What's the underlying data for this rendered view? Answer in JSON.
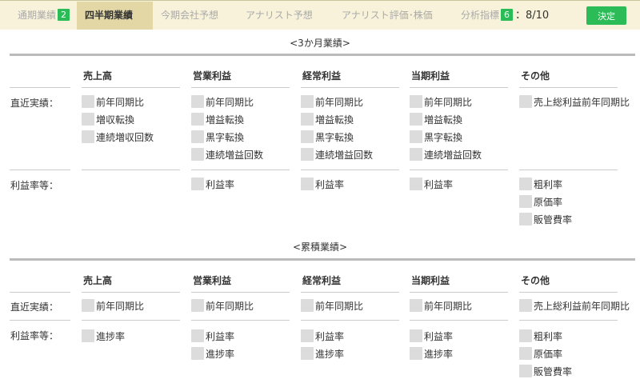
{
  "tabs": [
    {
      "label": "通期業績",
      "badge": "2"
    },
    {
      "label": "四半期業績"
    },
    {
      "label": "今期会社予想"
    },
    {
      "label": "アナリスト予想"
    },
    {
      "label": "アナリスト評価･株価"
    },
    {
      "label": "分析指標",
      "badge": "6"
    }
  ],
  "counter": "：8/10",
  "decide_label": "決定",
  "columns": [
    "売上高",
    "営業利益",
    "経常利益",
    "当期利益",
    "その他"
  ],
  "quarterly": {
    "title": "<3か月業績>",
    "row1_label": "直近実績：",
    "row2_label": "利益率等：",
    "row1": [
      [
        "前年同期比",
        "増収転換",
        "連続増収回数"
      ],
      [
        "前年同期比",
        "増益転換",
        "黒字転換",
        "連続増益回数"
      ],
      [
        "前年同期比",
        "増益転換",
        "黒字転換",
        "連続増益回数"
      ],
      [
        "前年同期比",
        "増益転換",
        "黒字転換",
        "連続増益回数"
      ],
      [
        "売上総利益前年同期比"
      ]
    ],
    "row2": [
      [],
      [
        "利益率"
      ],
      [
        "利益率"
      ],
      [
        "利益率"
      ],
      [
        "粗利率",
        "原価率",
        "販管費率"
      ]
    ]
  },
  "cumulative": {
    "title": "<累積業績>",
    "row1_label": "直近実績：",
    "row2_label": "利益率等：",
    "row1": [
      [
        "前年同期比"
      ],
      [
        "前年同期比"
      ],
      [
        "前年同期比"
      ],
      [
        "前年同期比"
      ],
      [
        "売上総利益前年同期比"
      ]
    ],
    "row2": [
      [
        "進捗率"
      ],
      [
        "利益率",
        "進捗率"
      ],
      [
        "利益率",
        "進捗率"
      ],
      [
        "利益率",
        "進捗率"
      ],
      [
        "粗利率",
        "原価率",
        "販管費率"
      ]
    ]
  }
}
